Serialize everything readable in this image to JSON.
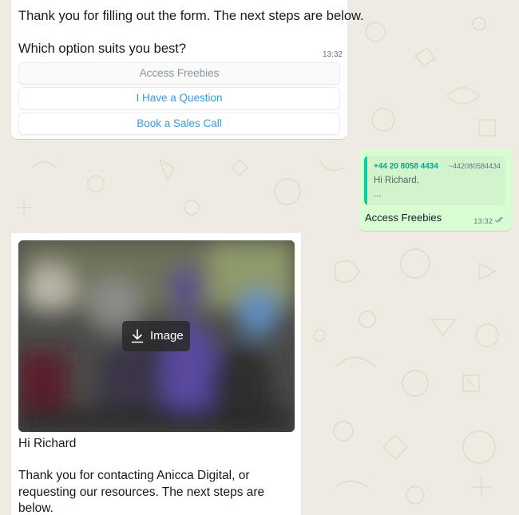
{
  "colors": {
    "chat_background": "#efeae2",
    "incoming_bubble": "#ffffff",
    "outgoing_bubble": "#d9fdd3",
    "link_button_text": "#3a9ad9",
    "quote_accent": "#06cf9c"
  },
  "messages": [
    {
      "direction": "incoming",
      "text_line1": "Thank you for filling out the form. The next steps are below.",
      "text_line2": "Which option suits you best?",
      "time": "13:32",
      "buttons": [
        {
          "label": "Access Freebies",
          "state": "disabled"
        },
        {
          "label": "I Have a Question",
          "state": "enabled"
        },
        {
          "label": "Book a Sales Call",
          "state": "enabled"
        }
      ]
    },
    {
      "direction": "outgoing",
      "quoted": {
        "sender_phone": "+44 20 8058 4434",
        "sender_pushname": "~442080584434",
        "line1": "Hi Richard,",
        "line2": "..."
      },
      "text": "Access Freebies",
      "time": "13:32",
      "status_icon": "double-check-icon"
    },
    {
      "direction": "incoming",
      "media_label": "Image",
      "media_icon": "download-icon",
      "lines": [
        "Hi Richard",
        "Thank you for contacting Anicca Digital, or",
        "requesting our resources. The next steps are",
        "below."
      ]
    }
  ]
}
